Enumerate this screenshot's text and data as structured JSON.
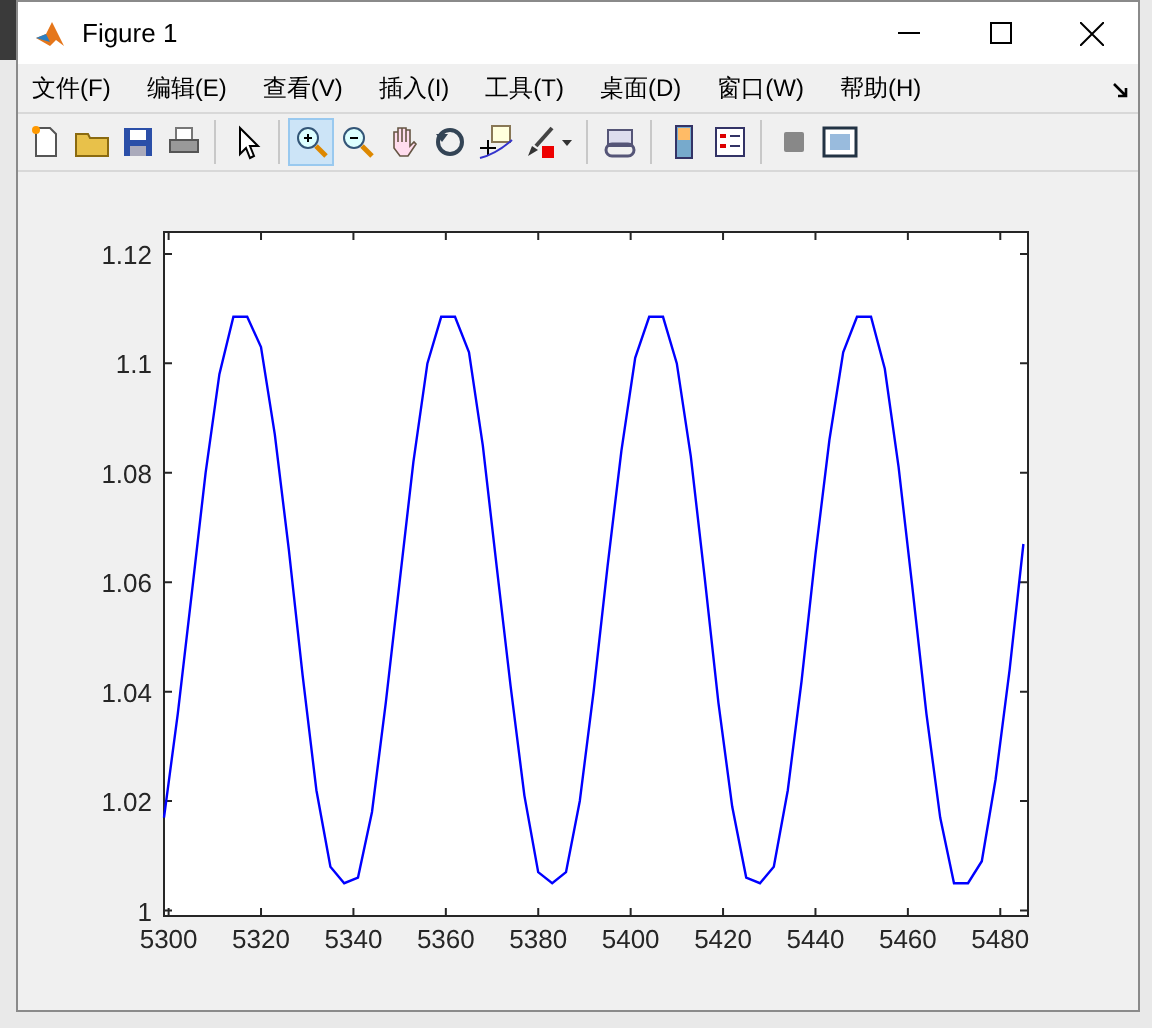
{
  "window": {
    "title": "Figure 1"
  },
  "menu": [
    {
      "label": "文件(F)"
    },
    {
      "label": "编辑(E)"
    },
    {
      "label": "查看(V)"
    },
    {
      "label": "插入(I)"
    },
    {
      "label": "工具(T)"
    },
    {
      "label": "桌面(D)"
    },
    {
      "label": "窗口(W)"
    },
    {
      "label": "帮助(H)"
    }
  ],
  "toolbar": [
    {
      "selected": false
    },
    {
      "selected": false
    },
    {
      "selected": false
    },
    {
      "selected": false
    },
    {
      "selected": false
    },
    {
      "selected": true
    },
    {
      "selected": false
    },
    {
      "selected": false
    },
    {
      "selected": false
    },
    {
      "selected": false
    },
    {
      "selected": false
    },
    {
      "selected": false
    },
    {
      "selected": false
    },
    {
      "selected": false
    },
    {
      "selected": false
    },
    {
      "selected": false
    }
  ],
  "chart_data": {
    "type": "line",
    "xlim": [
      5299,
      5486
    ],
    "ylim": [
      0.999,
      1.124
    ],
    "xticks": [
      5300,
      5320,
      5340,
      5360,
      5380,
      5400,
      5420,
      5440,
      5460,
      5480
    ],
    "yticks": [
      1,
      1.02,
      1.04,
      1.06,
      1.08,
      1.1,
      1.12
    ],
    "x": [
      5299,
      5302,
      5305,
      5308,
      5311,
      5314,
      5317,
      5320,
      5323,
      5326,
      5329,
      5332,
      5335,
      5338,
      5341,
      5344,
      5347,
      5350,
      5353,
      5356,
      5359,
      5362,
      5365,
      5368,
      5371,
      5374,
      5377,
      5380,
      5383,
      5386,
      5389,
      5392,
      5395,
      5398,
      5401,
      5404,
      5407,
      5410,
      5413,
      5416,
      5419,
      5422,
      5425,
      5428,
      5431,
      5434,
      5437,
      5440,
      5443,
      5446,
      5449,
      5452,
      5455,
      5458,
      5461,
      5464,
      5467,
      5470,
      5473,
      5476,
      5479,
      5482,
      5485
    ],
    "series": [
      {
        "color": "#0000ff",
        "values": [
          1.017,
          1.036,
          1.058,
          1.08,
          1.098,
          1.1085,
          1.1085,
          1.103,
          1.087,
          1.066,
          1.043,
          1.022,
          1.008,
          1.005,
          1.006,
          1.018,
          1.038,
          1.06,
          1.082,
          1.1,
          1.1085,
          1.1085,
          1.102,
          1.085,
          1.063,
          1.041,
          1.021,
          1.007,
          1.005,
          1.007,
          1.02,
          1.04,
          1.063,
          1.084,
          1.101,
          1.1085,
          1.1085,
          1.1,
          1.083,
          1.061,
          1.038,
          1.019,
          1.006,
          1.005,
          1.008,
          1.022,
          1.042,
          1.065,
          1.086,
          1.102,
          1.1085,
          1.1085,
          1.099,
          1.081,
          1.059,
          1.036,
          1.017,
          1.005,
          1.005,
          1.009,
          1.024,
          1.044,
          1.067
        ]
      }
    ]
  }
}
